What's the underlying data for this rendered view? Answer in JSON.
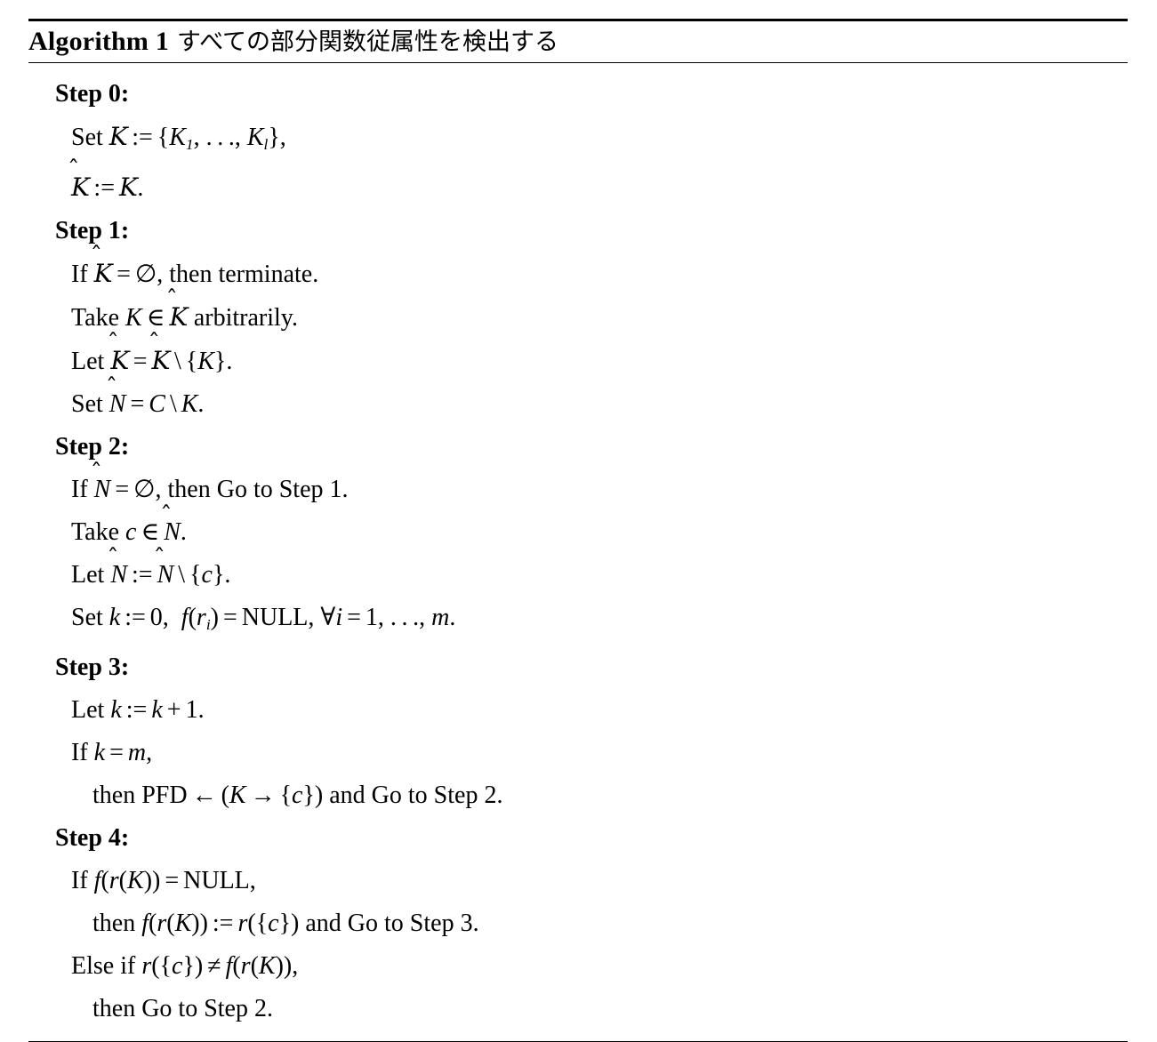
{
  "algorithm": {
    "label": "Algorithm 1",
    "title": "すべての部分関数従属性を検出する",
    "steps": [
      {
        "header": "Step 0:",
        "lines": [
          {
            "indent": false,
            "text": "Set 𝒦 := {K₁, … , K_l},"
          },
          {
            "indent": false,
            "text": "𝒦̂ := 𝒦."
          }
        ]
      },
      {
        "header": "Step 1:",
        "lines": [
          {
            "indent": false,
            "text": "If 𝒦̂ = ∅, then terminate."
          },
          {
            "indent": false,
            "text": "Take K ∈ 𝒦̂ arbitrarily."
          },
          {
            "indent": false,
            "text": "Let 𝒦̂ = 𝒦̂ \\ {K}."
          },
          {
            "indent": false,
            "text": "Set N̂ = C \\ K."
          }
        ]
      },
      {
        "header": "Step 2:",
        "lines": [
          {
            "indent": false,
            "text": "If N̂ = ∅, then Go to Step 1."
          },
          {
            "indent": false,
            "text": "Take c ∈ N̂."
          },
          {
            "indent": false,
            "text": "Let N̂ := N̂ \\ {c}."
          },
          {
            "indent": false,
            "text": "Set k := 0, f(r_i) = NULL, ∀i = 1, … , m."
          }
        ]
      },
      {
        "header": "Step 3:",
        "lines": [
          {
            "indent": false,
            "text": "Let k := k + 1."
          },
          {
            "indent": false,
            "text": "If k = m,"
          },
          {
            "indent": true,
            "text": "then PFD ← (K → {c}) and Go to Step 2."
          }
        ]
      },
      {
        "header": "Step 4:",
        "lines": [
          {
            "indent": false,
            "text": "If f(r(K)) = NULL,"
          },
          {
            "indent": true,
            "text": "then f(r(K)) := r({c}) and Go to Step 3."
          },
          {
            "indent": false,
            "text": "Else if r({c}) ≠ f(r(K)),"
          },
          {
            "indent": true,
            "text": "then Go to Step 2."
          }
        ]
      }
    ]
  },
  "symbols": {
    "empty_set": "∅",
    "element_of": "∈",
    "set_minus": "\\",
    "forall": "∀",
    "leftarrow": "←",
    "rightarrow": "→",
    "not_equal": "≠",
    "assign": ":=",
    "ellipsis": "…",
    "script_k": "𝒦",
    "hat": "^"
  },
  "colors": {
    "text": "#000000",
    "background": "#ffffff",
    "rule": "#000000"
  }
}
